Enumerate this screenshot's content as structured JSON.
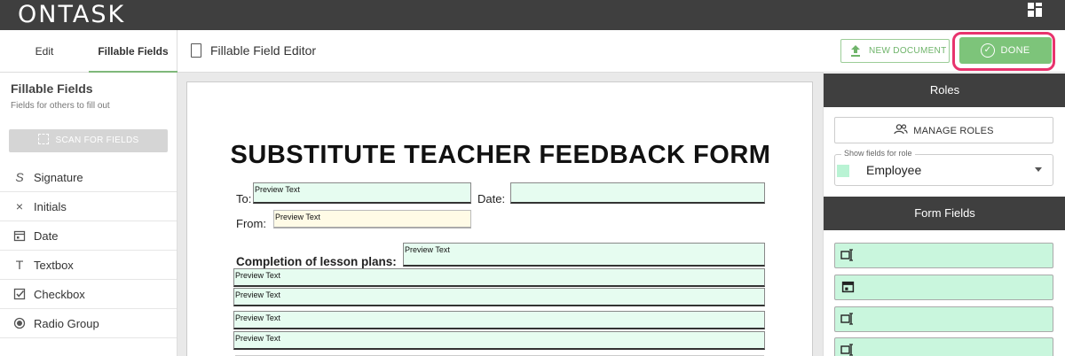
{
  "app": {
    "logo": "ONTASK"
  },
  "sidebar": {
    "tabs": [
      {
        "label": "Edit"
      },
      {
        "label": "Fillable Fields"
      }
    ],
    "title": "Fillable Fields",
    "subtitle": "Fields for others to fill out",
    "scan_label": "SCAN FOR FIELDS",
    "items": [
      {
        "label": "Signature",
        "icon": "signature-icon"
      },
      {
        "label": "Initials",
        "icon": "initials-icon"
      },
      {
        "label": "Date",
        "icon": "calendar-icon"
      },
      {
        "label": "Textbox",
        "icon": "text-icon"
      },
      {
        "label": "Checkbox",
        "icon": "checkbox-icon"
      },
      {
        "label": "Radio Group",
        "icon": "radio-icon"
      }
    ]
  },
  "header": {
    "title": "Fillable Field Editor",
    "new_document": "NEW DOCUMENT",
    "done": "DONE"
  },
  "document": {
    "title": "SUBSTITUTE TEACHER FEEDBACK FORM",
    "to_label": "To:",
    "date_label": "Date:",
    "from_label": "From:",
    "completion_label": "Completion of lesson plans:",
    "preview": "Preview Text"
  },
  "roles_panel": {
    "header": "Roles",
    "manage_roles": "MANAGE ROLES",
    "show_fields_label": "Show fields for role",
    "selected_role": "Employee",
    "role_color": "#b9f3d4"
  },
  "form_fields_panel": {
    "header": "Form Fields",
    "fields": [
      {
        "icon": "textbox-icon"
      },
      {
        "icon": "calendar-icon"
      },
      {
        "icon": "textbox-icon"
      },
      {
        "icon": "textbox-icon"
      }
    ]
  },
  "colors": {
    "accent": "#7dc47a",
    "highlight_ring": "#e8336d",
    "field_fill": "#e6fcf0",
    "field_fill_alt": "#fffbe6",
    "topbar": "#3f3f3f"
  }
}
